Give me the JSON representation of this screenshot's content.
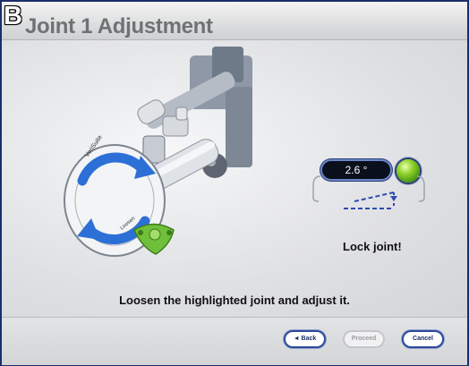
{
  "panel_letter": "B",
  "title": "Joint 1 Adjustment",
  "angle": {
    "value": "2.6 °"
  },
  "status_light_color": "#7cc52a",
  "lock_message": "Lock joint!",
  "instruction": "Loosen the highlighted joint and adjust it.",
  "illustration": {
    "brand_text": "VeriSuite",
    "dial_text": "Loosen"
  },
  "buttons": {
    "back": "◄ Back",
    "proceed": "Proceed",
    "cancel": "Cancel"
  },
  "colors": {
    "accent_blue": "#2d4b9b",
    "highlight_green": "#6fbf3a",
    "arrow_blue": "#2c6fd6"
  }
}
